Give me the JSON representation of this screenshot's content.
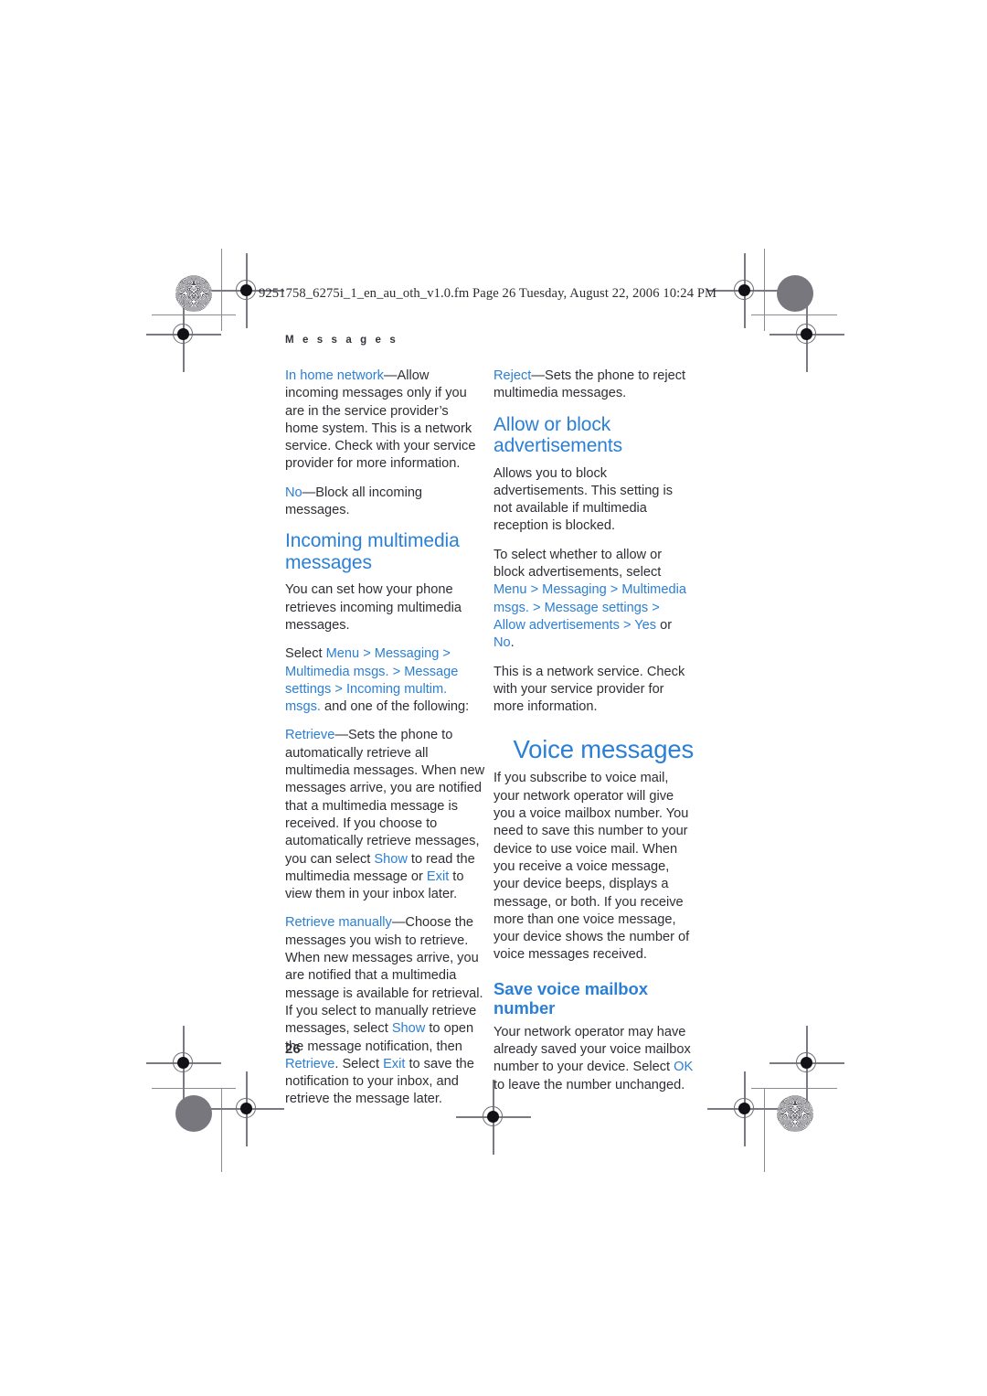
{
  "page": {
    "file_line": "9251758_6275i_1_en_au_oth_v1.0.fm  Page 26  Tuesday, August 22, 2006  10:24 PM",
    "running_head": "M e s s a g e s",
    "folio": "26",
    "accent_color": "#2b7fd4",
    "body_color": "#2e2e34"
  },
  "left_column": {
    "para_in_home_network": {
      "term": "In home network",
      "dash": "—",
      "text": "Allow incoming messages only if you are in the service provider’s home system. This is a network service. Check with your service provider for more information."
    },
    "para_no": {
      "term": "No",
      "dash": "—",
      "text": "Block all incoming messages."
    },
    "heading_incoming": "Incoming multimedia messages",
    "para_intro": "You can set how your phone retrieves incoming multimedia messages.",
    "path_select": {
      "lead": "Select ",
      "menu": "Menu",
      "sep1": " > ",
      "messaging": "Messaging",
      "sep2": " > ",
      "multimedia_msgs": "Multimedia msgs.",
      "sep3": " > ",
      "message_settings": "Message settings",
      "sep4": " > ",
      "incoming_multim": "Incoming multim. msgs.",
      "trail": " and one of the following:"
    },
    "para_retrieve": {
      "term": "Retrieve",
      "dash": "—",
      "text_a": "Sets the phone to automatically retrieve all multimedia messages. When new messages arrive, you are notified that a multimedia message is received. If you choose to automatically retrieve messages, you can select ",
      "ui_show": "Show",
      "text_b": " to read the multimedia message or ",
      "ui_exit": "Exit",
      "text_c": " to view them in your inbox later."
    },
    "para_retrieve_manually": {
      "term": "Retrieve manually",
      "dash": "—",
      "text_a": "Choose the messages you wish to retrieve. When new messages arrive, you are notified that a multimedia message is available for retrieval. If you select to manually retrieve messages, select ",
      "ui_show": "Show",
      "text_b": " to open the message notification, then ",
      "ui_retrieve": "Retrieve",
      "text_c": ". Select ",
      "ui_exit": "Exit",
      "text_d": " to save the notification to your inbox, and retrieve the message later."
    }
  },
  "right_column": {
    "para_reject": {
      "term": "Reject",
      "dash": "—",
      "text": "Sets the phone to reject multimedia messages."
    },
    "heading_allow_block": "Allow or block advertisements",
    "para_allows": "Allows you to block advertisements. This setting is not available if multimedia reception is blocked.",
    "path_ads": {
      "lead": "To select whether to allow or block advertisements, select ",
      "menu": "Menu",
      "sep1": " > ",
      "messaging": "Messaging",
      "sep2": " > ",
      "multimedia_msgs": "Multimedia msgs.",
      "sep3": " > ",
      "message_settings": "Message settings",
      "sep4": " > ",
      "allow_advertisements": "Allow advertisements",
      "sep5": " > ",
      "yes": "Yes",
      "or": " or ",
      "no": "No",
      "period": "."
    },
    "para_network_service": "This is a network service. Check with your service provider for more information.",
    "chapter_title": "Voice messages",
    "para_voice_mail": "If you subscribe to voice mail, your network operator will give you a voice mailbox number. You need to save this number to your device to use voice mail. When you receive a voice message, your device beeps, displays a message, or both. If you receive more than one voice message, your device shows the number of voice messages received.",
    "heading_save_mailbox": "Save voice mailbox number",
    "para_save_mailbox": {
      "text_a": "Your network operator may have already saved your voice mailbox number to your device. Select ",
      "ui_ok": "OK",
      "text_b": " to leave the number unchanged."
    }
  },
  "marks": {
    "registration_icon": "registration-target-icon",
    "starburst_icon": "starburst-density-icon",
    "graydot_icon": "solid-density-patch-icon"
  }
}
